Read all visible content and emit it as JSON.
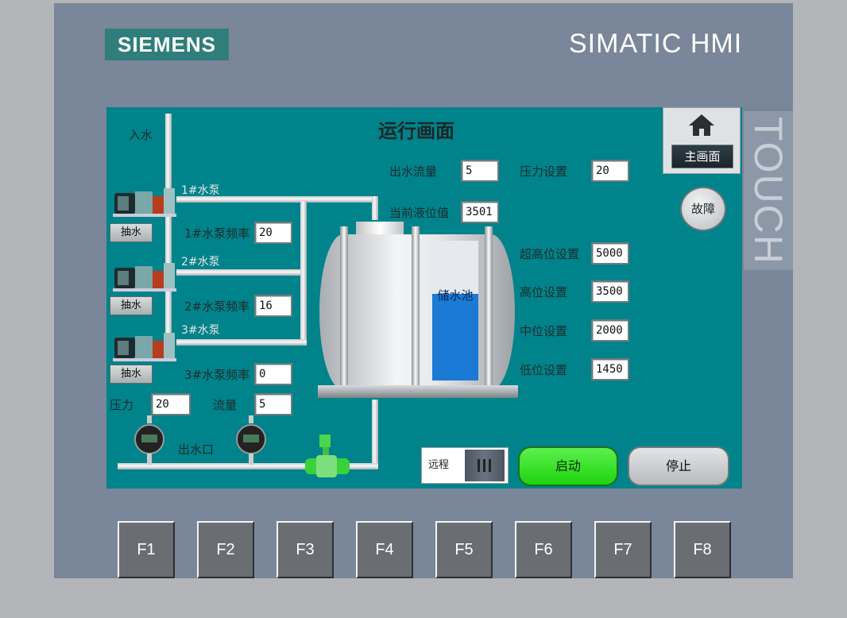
{
  "brand": "SIEMENS",
  "model": "SIMATIC HMI",
  "side_label": "TOUCH",
  "screen": {
    "title": "运行画面",
    "inlet_label": "入水",
    "outlet_label": "出水口",
    "pumps": [
      {
        "name": "1#水泵",
        "freq_label": "1#水泵频率",
        "freq": "20",
        "button": "抽水"
      },
      {
        "name": "2#水泵",
        "freq_label": "2#水泵频率",
        "freq": "16",
        "button": "抽水"
      },
      {
        "name": "3#水泵",
        "freq_label": "3#水泵频率",
        "freq": "0",
        "button": "抽水"
      }
    ],
    "pressure_label": "压力",
    "pressure": "20",
    "flow_label": "流量",
    "flow": "5",
    "outflow_label": "出水流量",
    "outflow": "5",
    "level_label": "当前液位值",
    "level": "3501",
    "pressure_set_label": "压力设置",
    "pressure_set": "20",
    "tank_label": "储水池",
    "tank_fill_percent": 62,
    "setpoints": [
      {
        "label": "超高位设置",
        "value": "5000"
      },
      {
        "label": "高位设置",
        "value": "3500"
      },
      {
        "label": "中位设置",
        "value": "2000"
      },
      {
        "label": "低位设置",
        "value": "1450"
      }
    ],
    "home_button": "主画面",
    "fault_button": "故障",
    "mode_switch": "远程",
    "start_button": "启动",
    "stop_button": "停止"
  },
  "function_keys": [
    "F1",
    "F2",
    "F3",
    "F4",
    "F5",
    "F6",
    "F7",
    "F8"
  ],
  "colors": {
    "screen_bg": "#00838a",
    "start_green": "#22dd11",
    "tank_water": "#1a7ad4",
    "brand_teal": "#2f7e7b"
  },
  "icons": {
    "home": "home-icon",
    "pump": "pump-icon",
    "gauge": "pressure-gauge-icon",
    "valve": "flow-valve-icon"
  }
}
